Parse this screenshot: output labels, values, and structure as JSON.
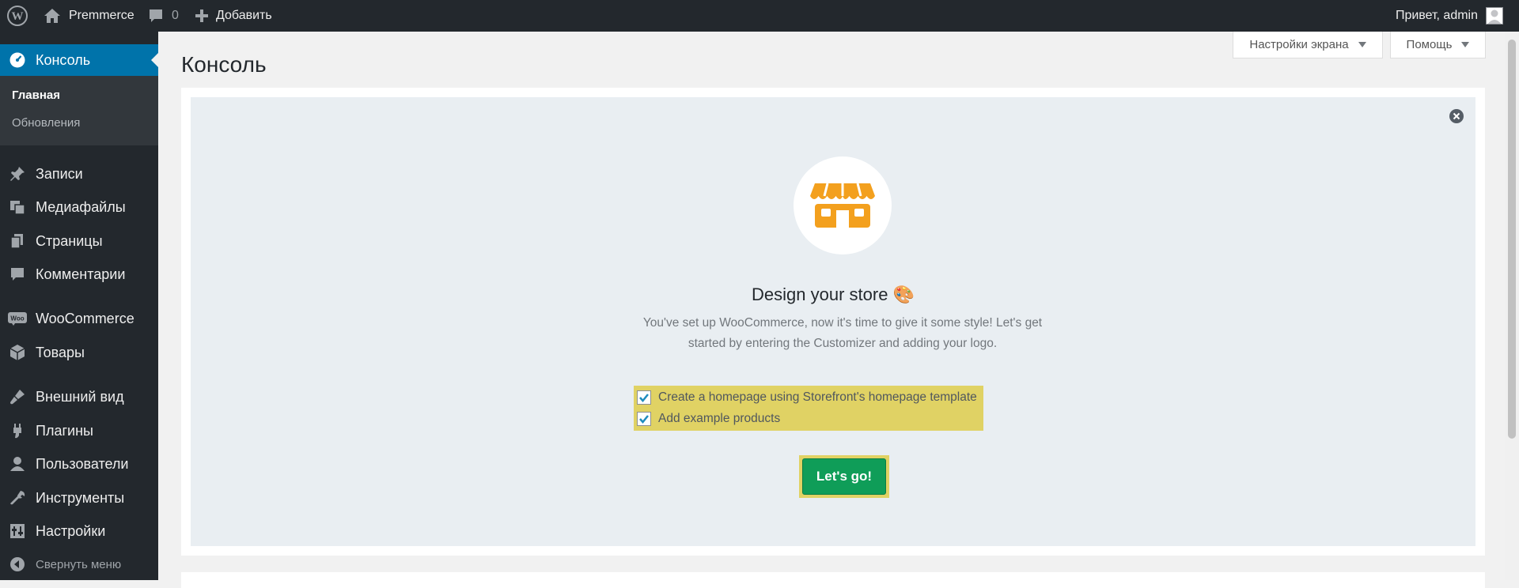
{
  "adminbar": {
    "site_name": "Premmerce",
    "comments_count": "0",
    "new_label": "Добавить",
    "greeting": "Привет, admin"
  },
  "sidebar": {
    "dashboard_label": "Консоль",
    "submenu": [
      "Главная",
      "Обновления"
    ],
    "items": [
      {
        "label": "Записи",
        "icon": "pin-icon"
      },
      {
        "label": "Медиафайлы",
        "icon": "media-icon"
      },
      {
        "label": "Страницы",
        "icon": "pages-icon"
      },
      {
        "label": "Комментарии",
        "icon": "comments-icon"
      },
      {
        "label": "WooCommerce",
        "icon": "woocommerce-icon"
      },
      {
        "label": "Товары",
        "icon": "products-icon"
      },
      {
        "label": "Внешний вид",
        "icon": "appearance-icon"
      },
      {
        "label": "Плагины",
        "icon": "plugins-icon"
      },
      {
        "label": "Пользователи",
        "icon": "users-icon"
      },
      {
        "label": "Инструменты",
        "icon": "tools-icon"
      },
      {
        "label": "Настройки",
        "icon": "settings-icon"
      }
    ],
    "collapse_label": "Свернуть меню"
  },
  "screen_options_label": "Настройки экрана",
  "help_label": "Помощь",
  "page_title": "Консоль",
  "panel": {
    "title": "Design your store",
    "emoji": "🎨",
    "description": "You've set up WooCommerce, now it's time to give it some style! Let's get started by entering the Customizer and adding your logo.",
    "checkbox_homepage": "Create a homepage using Storefront's homepage template",
    "checkbox_products": "Add example products",
    "button_label": "Let's go!"
  },
  "colors": {
    "sidebar_bg": "#23282d",
    "accent": "#0073aa",
    "store_icon": "#f3a01e",
    "button": "#0f9d58",
    "highlight": "#e0d264"
  }
}
